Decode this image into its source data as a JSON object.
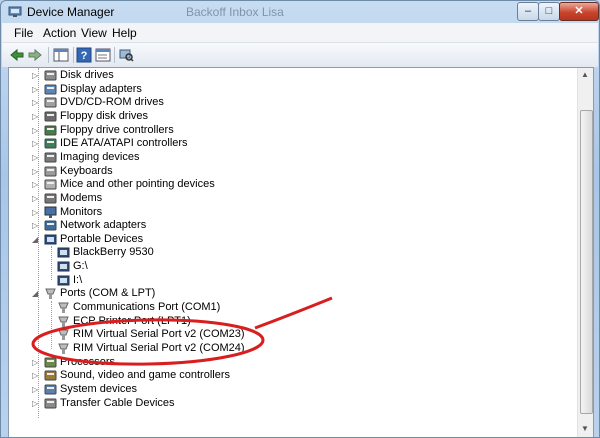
{
  "window": {
    "title": "Device Manager",
    "background_title": "Backoff Inbox Lisa"
  },
  "controls": {
    "minimize": "–",
    "maximize": "□",
    "close": "✕"
  },
  "menu": [
    "File",
    "Action",
    "View",
    "Help"
  ],
  "toolbar": {
    "buttons": [
      "back-arrow-icon",
      "forward-arrow-icon",
      "show-hide-tree-icon",
      "help-icon",
      "properties-icon",
      "scan-hardware-icon"
    ]
  },
  "tree": [
    {
      "label": "Disk drives",
      "icon": "disk-drive-icon",
      "expander": "collapsed"
    },
    {
      "label": "Display adapters",
      "icon": "display-adapter-icon",
      "expander": "collapsed"
    },
    {
      "label": "DVD/CD-ROM drives",
      "icon": "dvd-drive-icon",
      "expander": "collapsed"
    },
    {
      "label": "Floppy disk drives",
      "icon": "floppy-disk-icon",
      "expander": "collapsed"
    },
    {
      "label": "Floppy drive controllers",
      "icon": "floppy-controller-icon",
      "expander": "collapsed"
    },
    {
      "label": "IDE ATA/ATAPI controllers",
      "icon": "ide-controller-icon",
      "expander": "collapsed"
    },
    {
      "label": "Imaging devices",
      "icon": "imaging-device-icon",
      "expander": "collapsed"
    },
    {
      "label": "Keyboards",
      "icon": "keyboard-icon",
      "expander": "collapsed"
    },
    {
      "label": "Mice and other pointing devices",
      "icon": "mouse-icon",
      "expander": "collapsed"
    },
    {
      "label": "Modems",
      "icon": "modem-icon",
      "expander": "collapsed"
    },
    {
      "label": "Monitors",
      "icon": "monitor-icon",
      "expander": "collapsed"
    },
    {
      "label": "Network adapters",
      "icon": "network-adapter-icon",
      "expander": "collapsed"
    },
    {
      "label": "Portable Devices",
      "icon": "portable-device-icon",
      "expander": "expanded"
    },
    {
      "label": "BlackBerry 9530",
      "icon": "portable-device-icon",
      "expander": "none"
    },
    {
      "label": "G:\\",
      "icon": "portable-device-icon",
      "expander": "none"
    },
    {
      "label": "I:\\",
      "icon": "portable-device-icon",
      "expander": "none"
    },
    {
      "label": "Ports (COM & LPT)",
      "icon": "port-icon",
      "expander": "expanded"
    },
    {
      "label": "Communications Port (COM1)",
      "icon": "port-icon",
      "expander": "none"
    },
    {
      "label": "ECP Printer Port (LPT1)",
      "icon": "port-icon",
      "expander": "none"
    },
    {
      "label": "RIM Virtual Serial Port v2 (COM23)",
      "icon": "port-icon",
      "expander": "none"
    },
    {
      "label": "RIM Virtual Serial Port v2 (COM24)",
      "icon": "port-icon",
      "expander": "none"
    },
    {
      "label": "Processors",
      "icon": "processor-icon",
      "expander": "collapsed"
    },
    {
      "label": "Sound, video and game controllers",
      "icon": "sound-icon",
      "expander": "collapsed"
    },
    {
      "label": "System devices",
      "icon": "system-device-icon",
      "expander": "collapsed"
    },
    {
      "label": "Transfer Cable Devices",
      "icon": "transfer-cable-icon",
      "expander": "collapsed"
    }
  ],
  "colors": {
    "annotation_red": "#d81e1e",
    "title_gradient": "#a9c6e6",
    "content_bg": "#ffffff"
  }
}
